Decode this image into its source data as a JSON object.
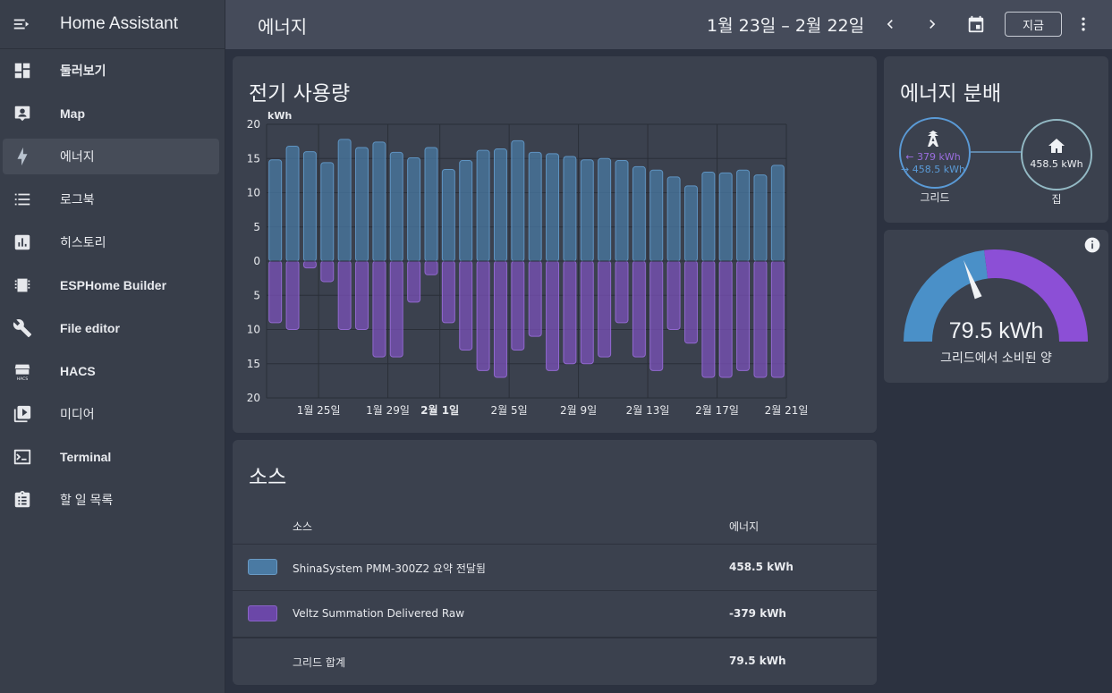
{
  "app": {
    "title": "Home Assistant"
  },
  "sidebar": {
    "items": [
      {
        "label": "둘러보기",
        "icon": "dashboard-icon"
      },
      {
        "label": "Map",
        "icon": "account-box-icon"
      },
      {
        "label": "에너지",
        "icon": "lightning-bolt-icon",
        "active": true
      },
      {
        "label": "로그북",
        "icon": "format-list-icon"
      },
      {
        "label": "히스토리",
        "icon": "chart-box-icon"
      },
      {
        "label": "ESPHome Builder",
        "icon": "chip-icon"
      },
      {
        "label": "File editor",
        "icon": "wrench-icon"
      },
      {
        "label": "HACS",
        "icon": "hacs-store-icon"
      },
      {
        "label": "미디어",
        "icon": "play-box-icon"
      },
      {
        "label": "Terminal",
        "icon": "console-icon"
      },
      {
        "label": "할 일 목록",
        "icon": "clipboard-list-icon"
      }
    ]
  },
  "topbar": {
    "title": "에너지",
    "date_range": "1월 23일 – 2월 22일",
    "now_label": "지금"
  },
  "usage_card": {
    "title": "전기 사용량"
  },
  "chart_data": {
    "type": "bar",
    "unit_label": "kWh",
    "y_ticks": [
      "20",
      "15",
      "10",
      "5",
      "0",
      "5",
      "10",
      "15",
      "20"
    ],
    "ylim": [
      -20,
      20
    ],
    "x_tick_labels": [
      {
        "label": "1월 25일",
        "index": 2,
        "bold": false
      },
      {
        "label": "1월 29일",
        "index": 6,
        "bold": false
      },
      {
        "label": "2월 1일",
        "index": 9,
        "bold": true
      },
      {
        "label": "2월 5일",
        "index": 13,
        "bold": false
      },
      {
        "label": "2월 9일",
        "index": 17,
        "bold": false
      },
      {
        "label": "2월 13일",
        "index": 21,
        "bold": false
      },
      {
        "label": "2월 17일",
        "index": 25,
        "bold": false
      },
      {
        "label": "2월 21일",
        "index": 29,
        "bold": false
      }
    ],
    "series": [
      {
        "name": "ShinaSystem PMM-300Z2 요약 전달됨",
        "color": "#4a7aa3",
        "values": [
          14.8,
          16.8,
          16.0,
          14.4,
          17.8,
          16.6,
          17.4,
          15.9,
          15.1,
          16.6,
          13.4,
          14.7,
          16.2,
          16.4,
          17.6,
          15.9,
          15.7,
          15.3,
          14.8,
          15.0,
          14.7,
          13.8,
          13.3,
          12.3,
          11.0,
          13.0,
          12.9,
          13.3,
          12.6,
          14.0
        ]
      },
      {
        "name": "Veltz Summation Delivered Raw",
        "color": "#7b52b9",
        "values": [
          -9.0,
          -10.0,
          -1.0,
          -3.0,
          -10.0,
          -10.0,
          -14.0,
          -14.0,
          -6.0,
          -2.0,
          -9.0,
          -13.0,
          -16.0,
          -17.0,
          -13.0,
          -11.0,
          -16.0,
          -15.0,
          -15.0,
          -14.0,
          -9.0,
          -14.0,
          -16.0,
          -10.0,
          -12.0,
          -17.0,
          -17.0,
          -16.0,
          -17.0,
          -17.0
        ]
      }
    ]
  },
  "distribution_card": {
    "title": "에너지 분배",
    "grid_in": "← 379 kWh",
    "grid_out": "→ 458.5 kWh",
    "grid_label": "그리드",
    "home_value": "458.5 kWh",
    "home_label": "집"
  },
  "gauge_card": {
    "value": "79.5 kWh",
    "label": "그리드에서 소비된 양",
    "fraction_consumed": 0.46
  },
  "sources_card": {
    "title": "소스",
    "col_source": "소스",
    "col_energy": "에너지",
    "rows": [
      {
        "name": "ShinaSystem PMM-300Z2 요약 전달됨",
        "value": "458.5 kWh",
        "color": "#4a7aa3",
        "border": "#6a9ac4"
      },
      {
        "name": "Veltz Summation Delivered Raw",
        "value": "-379 kWh",
        "color": "#6b47a8",
        "border": "#8a64c8"
      }
    ],
    "total_label": "그리드 합계",
    "total_value": "79.5 kWh"
  },
  "colors": {
    "accent_blue": "#4a90c8",
    "accent_purple": "#8c4fd6"
  }
}
